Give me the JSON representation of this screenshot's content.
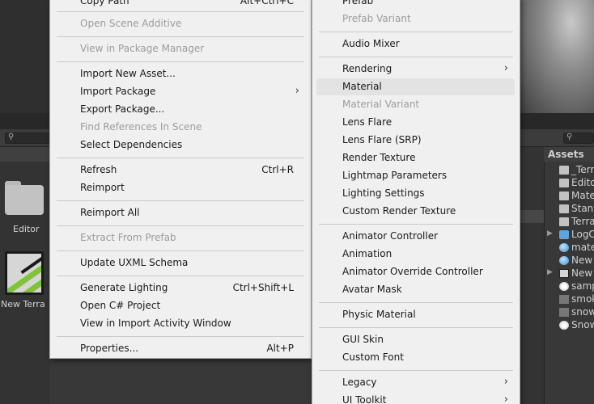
{
  "main_menu": {
    "items": [
      {
        "id": "copy-path",
        "label": "Copy Path",
        "shortcut": "Alt+Ctrl+C",
        "disabled": false
      },
      {
        "id": "open-scene-additive",
        "label": "Open Scene Additive",
        "shortcut": "",
        "disabled": true
      },
      {
        "id": "view-in-package-manager",
        "label": "View in Package Manager",
        "shortcut": "",
        "disabled": true
      },
      {
        "id": "import-new-asset",
        "label": "Import New Asset...",
        "shortcut": "",
        "disabled": false
      },
      {
        "id": "import-package",
        "label": "Import Package",
        "shortcut": "",
        "disabled": false,
        "submenu": true
      },
      {
        "id": "export-package",
        "label": "Export Package...",
        "shortcut": "",
        "disabled": false
      },
      {
        "id": "find-references-in-scene",
        "label": "Find References In Scene",
        "shortcut": "",
        "disabled": true
      },
      {
        "id": "select-dependencies",
        "label": "Select Dependencies",
        "shortcut": "",
        "disabled": false
      },
      {
        "id": "refresh",
        "label": "Refresh",
        "shortcut": "Ctrl+R",
        "disabled": false
      },
      {
        "id": "reimport",
        "label": "Reimport",
        "shortcut": "",
        "disabled": false
      },
      {
        "id": "reimport-all",
        "label": "Reimport All",
        "shortcut": "",
        "disabled": false
      },
      {
        "id": "extract-from-prefab",
        "label": "Extract From Prefab",
        "shortcut": "",
        "disabled": true
      },
      {
        "id": "update-uxml-schema",
        "label": "Update UXML Schema",
        "shortcut": "",
        "disabled": false
      },
      {
        "id": "generate-lighting",
        "label": "Generate Lighting",
        "shortcut": "Ctrl+Shift+L",
        "disabled": false
      },
      {
        "id": "open-csharp-project",
        "label": "Open C# Project",
        "shortcut": "",
        "disabled": false
      },
      {
        "id": "view-in-import-activity-window",
        "label": "View in Import Activity Window",
        "shortcut": "",
        "disabled": false
      },
      {
        "id": "properties",
        "label": "Properties...",
        "shortcut": "Alt+P",
        "disabled": false
      }
    ]
  },
  "sub_menu": {
    "items": [
      {
        "id": "prefab",
        "label": "Prefab",
        "disabled": false
      },
      {
        "id": "prefab-variant",
        "label": "Prefab Variant",
        "disabled": true
      },
      {
        "id": "audio-mixer",
        "label": "Audio Mixer",
        "disabled": false
      },
      {
        "id": "rendering",
        "label": "Rendering",
        "disabled": false,
        "submenu": true
      },
      {
        "id": "material",
        "label": "Material",
        "disabled": false,
        "highlighted": true
      },
      {
        "id": "material-variant",
        "label": "Material Variant",
        "disabled": true
      },
      {
        "id": "lens-flare",
        "label": "Lens Flare",
        "disabled": false
      },
      {
        "id": "lens-flare-srp",
        "label": "Lens Flare (SRP)",
        "disabled": false
      },
      {
        "id": "render-texture",
        "label": "Render Texture",
        "disabled": false
      },
      {
        "id": "lightmap-parameters",
        "label": "Lightmap Parameters",
        "disabled": false
      },
      {
        "id": "lighting-settings",
        "label": "Lighting Settings",
        "disabled": false
      },
      {
        "id": "custom-render-texture",
        "label": "Custom Render Texture",
        "disabled": false
      },
      {
        "id": "animator-controller",
        "label": "Animator Controller",
        "disabled": false
      },
      {
        "id": "animation",
        "label": "Animation",
        "disabled": false
      },
      {
        "id": "animator-override-controller",
        "label": "Animator Override Controller",
        "disabled": false
      },
      {
        "id": "avatar-mask",
        "label": "Avatar Mask",
        "disabled": false
      },
      {
        "id": "physic-material",
        "label": "Physic Material",
        "disabled": false
      },
      {
        "id": "gui-skin",
        "label": "GUI Skin",
        "disabled": false
      },
      {
        "id": "custom-font",
        "label": "Custom Font",
        "disabled": false
      },
      {
        "id": "legacy",
        "label": "Legacy",
        "disabled": false,
        "submenu": true
      },
      {
        "id": "ui-toolkit",
        "label": "UI Toolkit",
        "disabled": false,
        "submenu": true
      }
    ]
  },
  "project_grid": {
    "items": [
      {
        "label": "Editor",
        "icon": "folder-icon"
      },
      {
        "label": "New Terra",
        "icon": "terrain-icon"
      }
    ]
  },
  "assets_tree": {
    "header": "Assets",
    "rows": [
      {
        "name": "_Terr",
        "icon": "folder-icon",
        "expandable": false
      },
      {
        "name": "Edito",
        "icon": "folder-icon",
        "expandable": false
      },
      {
        "name": "Mate",
        "icon": "folder-icon",
        "expandable": false
      },
      {
        "name": "Stand",
        "icon": "folder-icon",
        "expandable": false
      },
      {
        "name": "Terra",
        "icon": "folder-icon",
        "expandable": false
      },
      {
        "name": "LogC",
        "icon": "cube-icon",
        "expandable": true
      },
      {
        "name": "mate",
        "icon": "sphere-icon",
        "expandable": false
      },
      {
        "name": "New",
        "icon": "sphere-icon",
        "expandable": false
      },
      {
        "name": "New",
        "icon": "terrain-icon",
        "expandable": true
      },
      {
        "name": "samp",
        "icon": "unity-icon",
        "expandable": false
      },
      {
        "name": "smok",
        "icon": "texture-icon",
        "expandable": false
      },
      {
        "name": "snow",
        "icon": "texture-icon",
        "expandable": false
      },
      {
        "name": "Snow",
        "icon": "unity-icon",
        "expandable": false
      }
    ]
  },
  "icons": {
    "submenu_arrow": "chevron-right-icon",
    "search": "search-icon",
    "expand": "triangle-right-icon"
  },
  "colors": {
    "menu_bg": "#f0f0f0",
    "menu_hover": "#e3e3e3",
    "disabled_text": "#9c9c9c",
    "editor_bg": "#383838",
    "terrain_green": "#7fc436"
  }
}
